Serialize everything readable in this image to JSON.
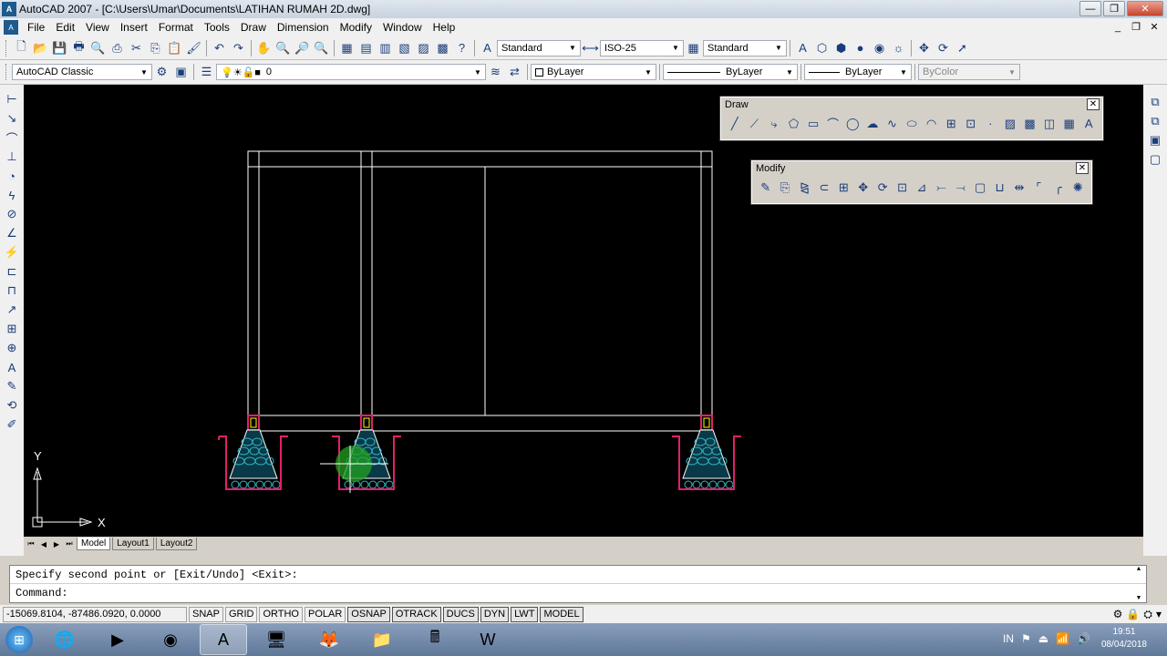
{
  "window": {
    "title": "AutoCAD 2007 - [C:\\Users\\Umar\\Documents\\LATIHAN RUMAH 2D.dwg]",
    "app_icon": "autocad-icon"
  },
  "menu": [
    "File",
    "Edit",
    "View",
    "Insert",
    "Format",
    "Tools",
    "Draw",
    "Dimension",
    "Modify",
    "Window",
    "Help"
  ],
  "toolbar1": {
    "text_style": "Standard",
    "dim_style": "ISO-25",
    "table_style": "Standard"
  },
  "toolbar2": {
    "workspace": "AutoCAD Classic",
    "layer": "0",
    "color": "ByLayer",
    "linetype": "ByLayer",
    "lineweight": "ByLayer",
    "plotstyle": "ByColor"
  },
  "draw_panel": {
    "title": "Draw"
  },
  "modify_panel": {
    "title": "Modify"
  },
  "ucs": {
    "x_label": "X",
    "y_label": "Y"
  },
  "tabs": [
    "Model",
    "Layout1",
    "Layout2"
  ],
  "command": {
    "line1": "Specify second point or [Exit/Undo] <Exit>:",
    "line2": "Command:"
  },
  "status": {
    "coords": "-15069.8104, -87486.0920, 0.0000",
    "buttons": [
      "SNAP",
      "GRID",
      "ORTHO",
      "POLAR",
      "OSNAP",
      "OTRACK",
      "DUCS",
      "DYN",
      "LWT",
      "MODEL"
    ],
    "active": [
      "OSNAP",
      "OTRACK",
      "DUCS",
      "DYN",
      "LWT",
      "MODEL"
    ]
  },
  "taskbar": {
    "language": "IN",
    "time": "19:51",
    "date": "08/04/2018"
  },
  "colors": {
    "canvas": "#000000",
    "walls": "#ffffff",
    "footing_outline": "#e0206a",
    "stone_fill": "#30b8c8",
    "column_marker": "#ffff00",
    "cursor_highlight": "#22a020"
  }
}
